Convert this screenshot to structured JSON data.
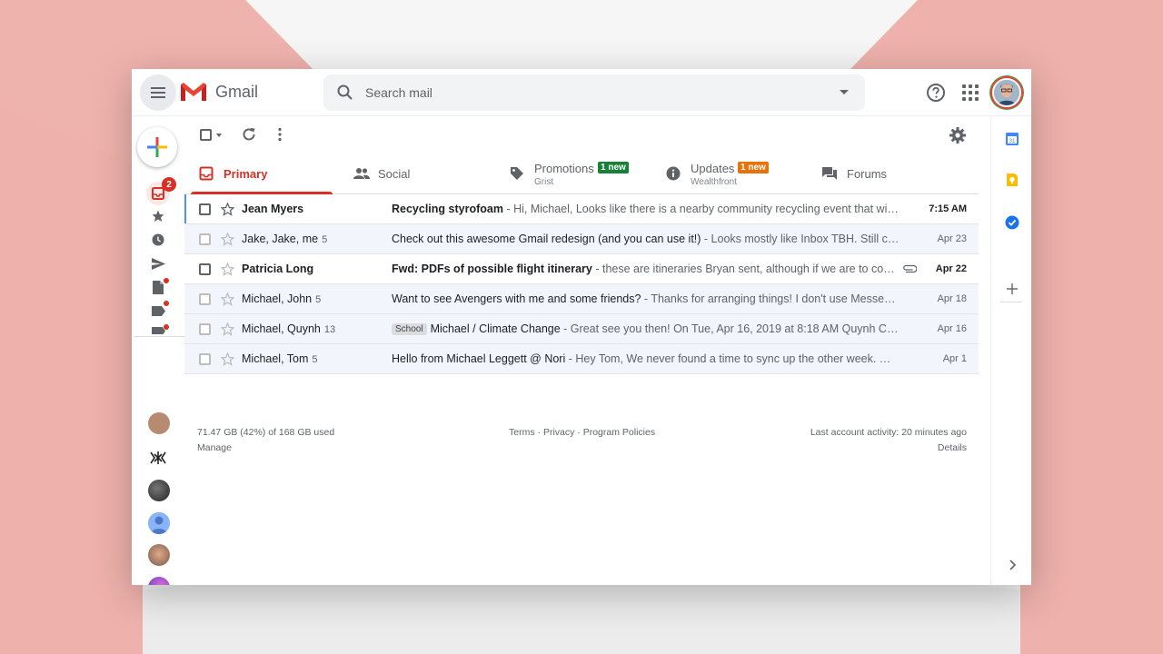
{
  "app": {
    "name": "Gmail"
  },
  "search": {
    "placeholder": "Search mail"
  },
  "rail": {
    "inbox_badge": "2"
  },
  "tabs": [
    {
      "label": "Primary",
      "sub": "",
      "badge": ""
    },
    {
      "label": "Social",
      "sub": "",
      "badge": ""
    },
    {
      "label": "Promotions",
      "sub": "Grist",
      "badge": "1 new",
      "badge_color": "#188038"
    },
    {
      "label": "Updates",
      "sub": "Wealthfront",
      "badge": "1 new",
      "badge_color": "#e8710a"
    },
    {
      "label": "Forums",
      "sub": "",
      "badge": ""
    }
  ],
  "emails": [
    {
      "sender": "Jean Myers",
      "count": "",
      "label": "",
      "subject": "Recycling styrofoam",
      "snippet": " - Hi, Michael, Looks like there is a nearby community recycling event that will take all of your styrofoam",
      "date": "7:15 AM",
      "unread": true,
      "attachment": false
    },
    {
      "sender": "Jake, Jake, me",
      "count": "5",
      "label": "",
      "subject": "Check out this awesome Gmail redesign (and you can use it!)",
      "snippet": " - Looks mostly like Inbox TBH. Still could be better",
      "date": "Apr 23",
      "unread": false,
      "attachment": false
    },
    {
      "sender": "Patricia Long",
      "count": "",
      "label": "",
      "subject": "Fwd: PDFs of possible flight itinerary",
      "snippet": " - these are itineraries Bryan sent, although if we are to come back earlier",
      "date": "Apr 22",
      "unread": true,
      "attachment": true
    },
    {
      "sender": "Michael, John",
      "count": "5",
      "label": "",
      "subject": "Want to see Avengers with me and some friends?",
      "snippet": " - Thanks for arranging things! I don't use Messenger, so please",
      "date": "Apr 18",
      "unread": false,
      "attachment": false
    },
    {
      "sender": "Michael, Quynh",
      "count": "13",
      "label": "School",
      "subject": "Michael / Climate Change",
      "snippet": " - Great see you then! On Tue, Apr 16, 2019 at 8:18 AM Quynh Cao <q",
      "date": "Apr 16",
      "unread": false,
      "attachment": false
    },
    {
      "sender": "Michael, Tom",
      "count": "5",
      "label": "",
      "subject": "Hello from Michael Leggett @ Nori",
      "snippet": " - Hey Tom, We never found a time to sync up the other week. Would you be",
      "date": "Apr 1",
      "unread": false,
      "attachment": false
    }
  ],
  "footer": {
    "storage": "71.47 GB (42%) of 168 GB used",
    "manage": "Manage",
    "terms": "Terms",
    "privacy": "Privacy",
    "policies": "Program Policies",
    "activity": "Last account activity: 20 minutes ago",
    "details": "Details"
  },
  "colors": {
    "accent": "#d93025",
    "brand_red": "#ea4335",
    "background": "#eeb1ab"
  }
}
